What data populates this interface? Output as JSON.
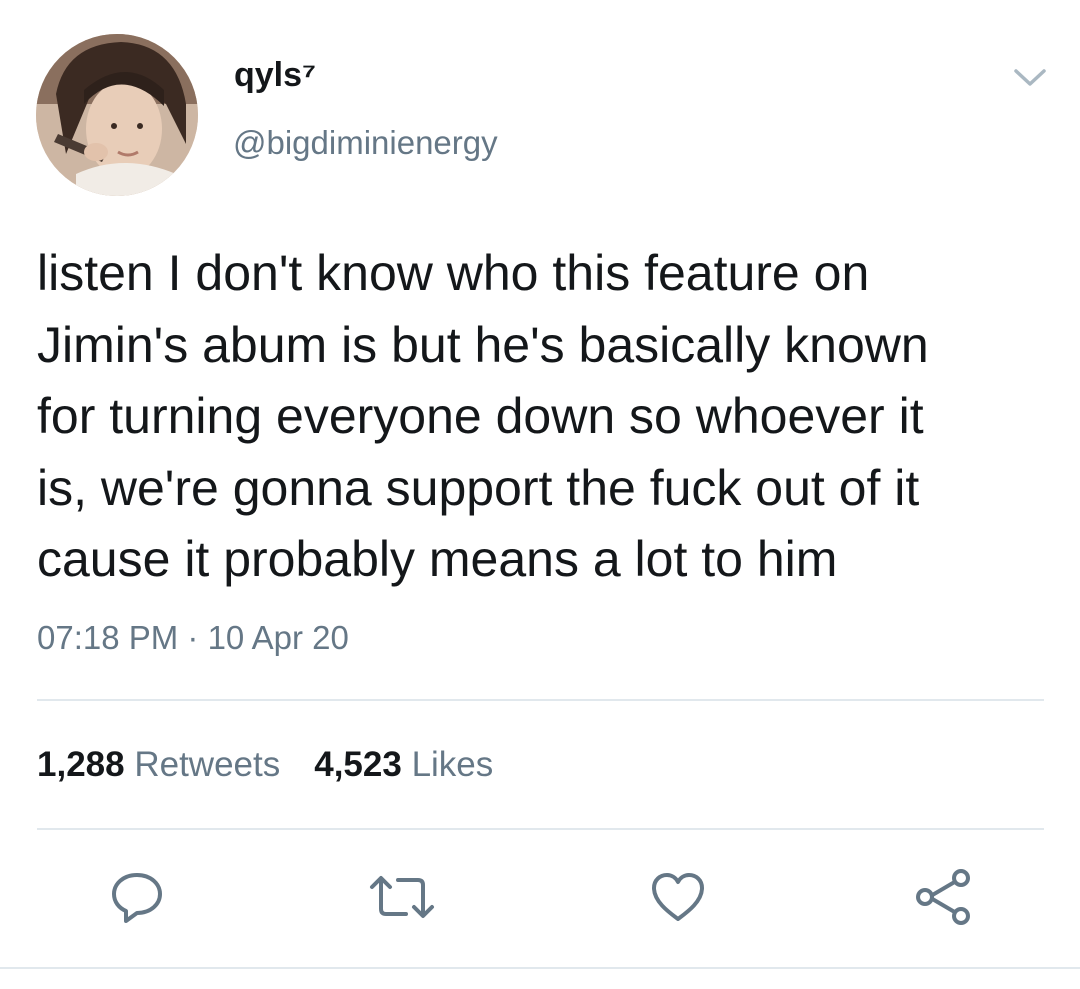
{
  "user": {
    "display_name": "qyls⁷",
    "handle": "@bigdiminienergy",
    "avatar_icon": "profile-photo"
  },
  "tweet": {
    "lines": [
      "listen I don't know who this feature on",
      "Jimin's abum is but he's basically known",
      "for turning everyone down so whoever it",
      "is, we're gonna support the fuck out of it",
      "cause it probably means a lot to him"
    ],
    "timestamp": "07:18 PM · 10 Apr 20"
  },
  "stats": {
    "retweets_count": "1,288",
    "retweets_label": "Retweets",
    "likes_count": "4,523",
    "likes_label": "Likes"
  },
  "actions": [
    {
      "name": "reply",
      "icon": "reply-icon"
    },
    {
      "name": "retweet",
      "icon": "retweet-icon"
    },
    {
      "name": "like",
      "icon": "heart-icon"
    },
    {
      "name": "share",
      "icon": "share-icon"
    }
  ],
  "colors": {
    "text": "#14171a",
    "secondary": "#657786",
    "divider": "#e1e8ed",
    "icon": "#657786"
  }
}
